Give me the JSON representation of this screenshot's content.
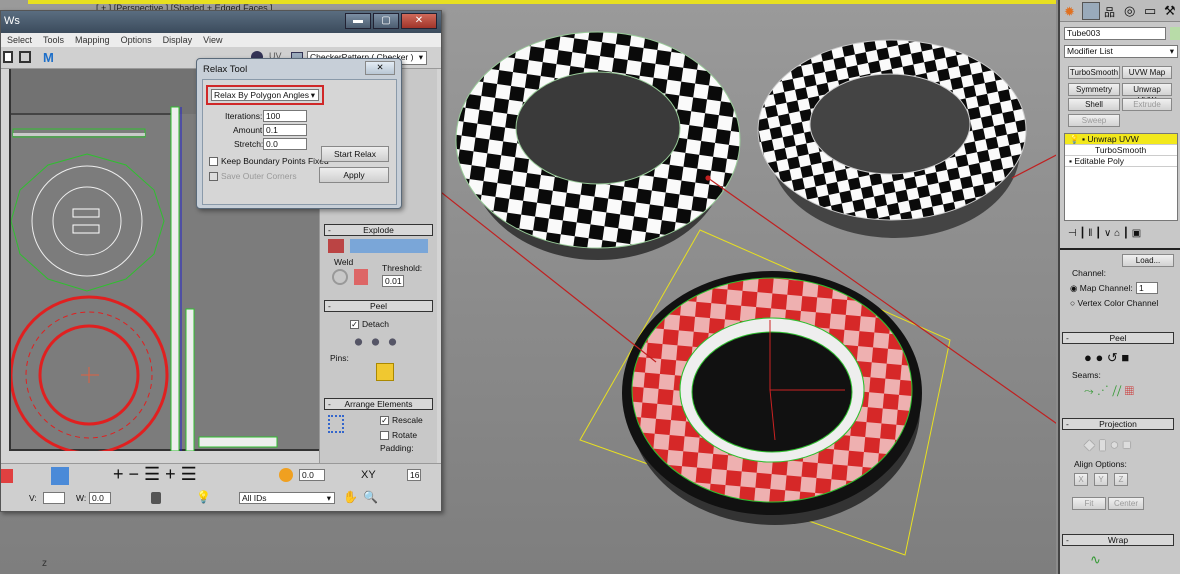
{
  "viewport": {
    "label": "[ + ] [Perspective ] [Shaded + Edged Faces ]"
  },
  "uvw_window": {
    "title": "Ws",
    "window_buttons": {
      "minimize": "▬",
      "maximize": "▢",
      "close": "✕"
    },
    "menu": [
      "Select",
      "Tools",
      "Mapping",
      "Options",
      "Display",
      "View"
    ],
    "uv_label": "UV",
    "texture_dropdown": "CheckerPattern  ( Checker )",
    "rollouts": {
      "explode": "Explode",
      "weld": "Weld",
      "threshold_label": "Threshold:",
      "threshold_value": "0.01",
      "peel": "Peel",
      "detach": "Detach",
      "pins": "Pins:",
      "arrange": "Arrange Elements",
      "rescale": "Rescale",
      "rotate": "Rotate",
      "padding": "Padding:"
    },
    "bottom_toolbar": {
      "value1": "0.0",
      "xy": "XY",
      "value2": "16",
      "v_label": "V:",
      "w_label": "W:",
      "w_value": "0.0",
      "ids_dropdown": "All IDs"
    }
  },
  "relax_tool": {
    "title": "Relax Tool",
    "close": "✕",
    "mode": "Relax By Polygon Angles",
    "iterations_label": "Iterations:",
    "iterations": "100",
    "amount_label": "Amount:",
    "amount": "0.1",
    "stretch_label": "Stretch:",
    "stretch": "0.0",
    "keep_boundary": "Keep Boundary Points Fixed",
    "save_corners": "Save Outer Corners",
    "start_relax": "Start Relax",
    "apply": "Apply"
  },
  "command_panel": {
    "object_name": "Tube003",
    "modifier_list": "Modifier List",
    "modifier_buttons": [
      "TurboSmooth",
      "UVW Map",
      "Symmetry",
      "Unwrap UVW",
      "Shell",
      "Extrude",
      "Sweep"
    ],
    "stack": [
      {
        "label": "Unwrap UVW",
        "selected": true
      },
      {
        "label": "TurboSmooth",
        "selected": false
      },
      {
        "label": "Editable Poly",
        "selected": false
      }
    ],
    "load": "Load...",
    "channel": "Channel:",
    "map_channel": "Map Channel:",
    "map_channel_value": "1",
    "vertex_color_channel": "Vertex Color Channel",
    "peel": "Peel",
    "seams": "Seams:",
    "projection": "Projection",
    "align_options": "Align Options:",
    "align_buttons": [
      "X",
      "Y",
      "Z"
    ],
    "fit": "Fit",
    "center": "Center",
    "wrap": "Wrap"
  },
  "colors": {
    "highlight": "#f2e81c",
    "annotation": "#cc2222",
    "selection": "#e02020",
    "uv_edge": "#2fbf2f"
  }
}
